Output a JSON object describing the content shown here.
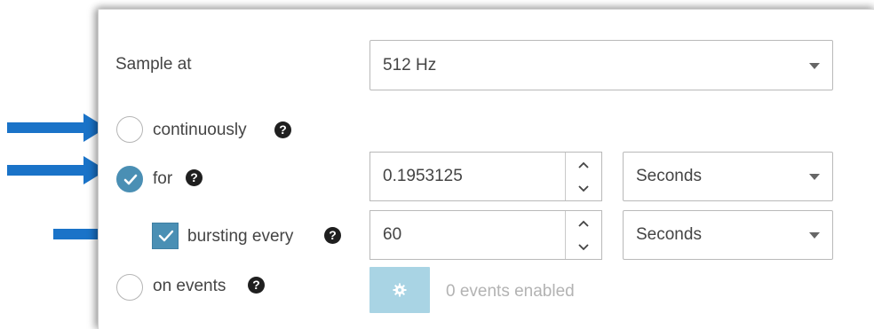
{
  "sample_at": {
    "label": "Sample at",
    "frequency": "512 Hz"
  },
  "modes": {
    "continuously": {
      "label": "continuously",
      "selected": false
    },
    "for": {
      "label": "for",
      "selected": true,
      "duration_value": "0.1953125",
      "duration_unit": "Seconds"
    },
    "bursting": {
      "label": "bursting every",
      "checked": true,
      "interval_value": "60",
      "interval_unit": "Seconds"
    },
    "on_events": {
      "label": "on events",
      "selected": false,
      "status_text": "0 events enabled"
    }
  },
  "help_glyph": "?",
  "colors": {
    "accent": "#4a8fb4",
    "arrow": "#1a73c8",
    "gear_button": "#a9d4e4",
    "muted_text": "#b3b3b3"
  },
  "icons": {
    "help": "question-circle-icon",
    "gear": "gear-icon",
    "radio_check": "check-icon",
    "arrow": "right-arrow-icon"
  }
}
